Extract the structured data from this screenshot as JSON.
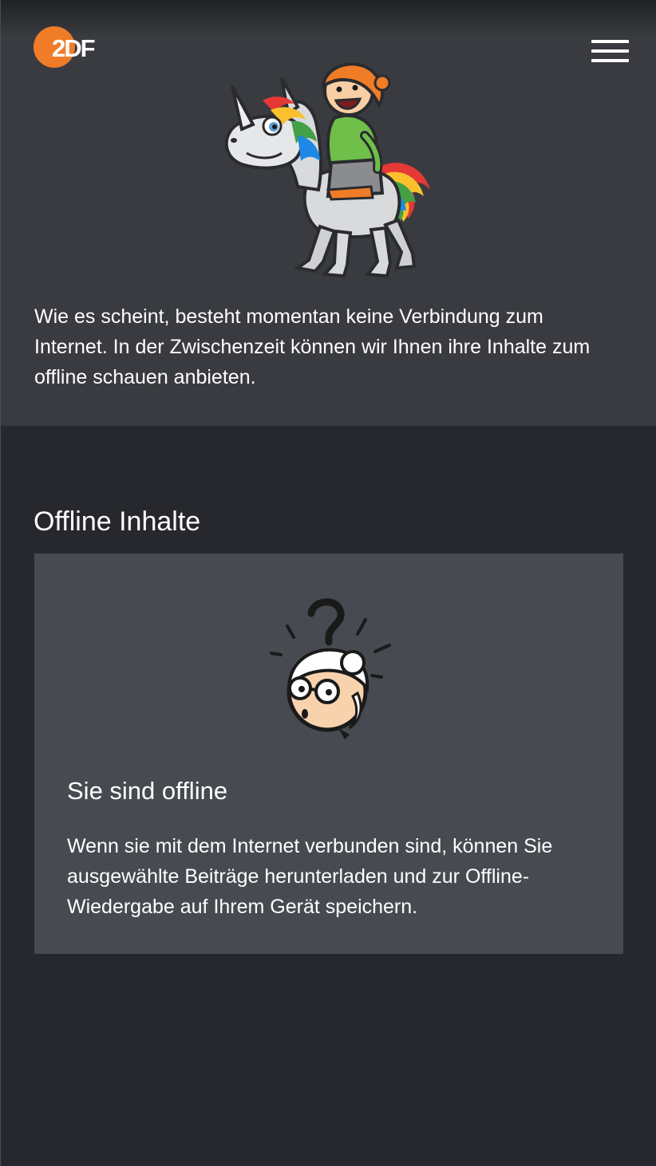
{
  "header": {
    "logo_text": "2DF",
    "menu_icon": "hamburger-menu-icon",
    "brand_color": "#f07c27"
  },
  "hero": {
    "illustration": "unicorn-rider-illustration",
    "message": "Wie es scheint, besteht momentan keine Verbindung zum Internet. In der Zwischenzeit können wir Ihnen ihre Inhalte zum offline schauen anbieten."
  },
  "offline_section": {
    "title": "Offline Inhalte",
    "card": {
      "illustration": "confused-grandma-illustration",
      "title": "Sie sind offline",
      "text": "Wenn sie mit dem Internet verbunden sind, können Sie ausgewählte Beiträge herunterladen und zur Offline-Wiedergabe auf Ihrem Gerät speichern."
    }
  },
  "colors": {
    "page_background": "#26282d",
    "top_background": "#393b40",
    "card_background": "#474a50",
    "text": "#ffffff"
  }
}
